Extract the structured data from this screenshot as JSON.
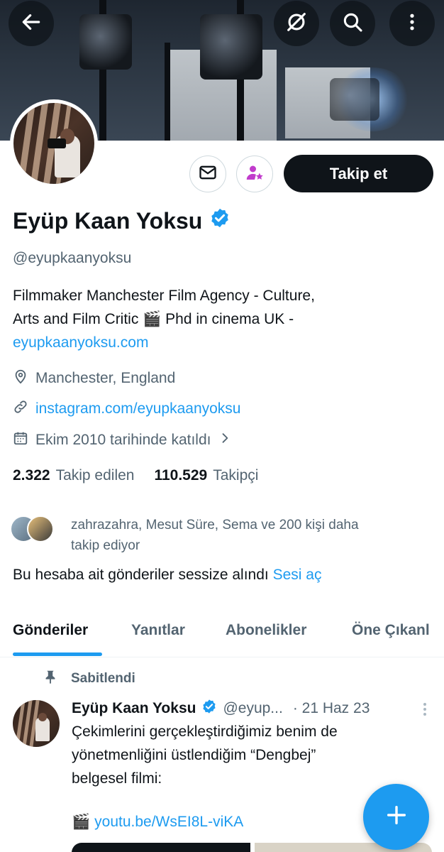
{
  "header": {
    "back_icon": "arrow-left-icon",
    "grok_icon": "slash-circle-icon",
    "search_icon": "search-icon",
    "more_icon": "more-vertical-icon"
  },
  "profile": {
    "name": "Eyüp Kaan Yoksu",
    "verified": true,
    "handle": "@eyupkaanyoksu",
    "bio_line1": "Filmmaker Manchester Film Agency  - Culture,",
    "bio_line2_prefix": "Arts and Film Critic ",
    "bio_line2_emoji": "🎬",
    "bio_line2_suffix": " Phd in cinema UK -",
    "bio_link": "eyupkaanyoksu.com",
    "location": "Manchester, England",
    "website": "instagram.com/eyupkaanyoksu",
    "joined": "Ekim 2010 tarihinde katıldı",
    "following_count": "2.322",
    "following_label": "Takip edilen",
    "followers_count": "110.529",
    "followers_label": "Takipçi",
    "mutual_text_line1": "zahrazahra, Mesut Süre, Sema ve 200 kişi daha",
    "mutual_text_line2": "takip ediyor",
    "muted_text": "Bu hesaba ait gönderiler sessize alındı",
    "unmute_link": "Sesi aç"
  },
  "actions": {
    "message_icon": "envelope-icon",
    "subscribe_icon": "person-star-icon",
    "follow_label": "Takip et"
  },
  "tabs": [
    {
      "label": "Gönderiler",
      "active": true
    },
    {
      "label": "Yanıtlar",
      "active": false
    },
    {
      "label": "Abonelikler",
      "active": false
    },
    {
      "label": "Öne Çıkanl",
      "active": false
    }
  ],
  "post": {
    "pinned_label": "Sabitlendi",
    "author": "Eyüp Kaan Yoksu",
    "handle": "@eyup...",
    "date": "· 21 Haz 23",
    "text_line1": "Çekimlerini gerçekleştirdiğimiz benim de",
    "text_line2": "yönetmenliğini üstlendiğim “Dengbej”",
    "text_line3": "belgesel filmi:",
    "link_emoji": "🎬",
    "link": "youtu.be/WsEI8L-viKA"
  },
  "fab": {
    "icon": "plus-icon"
  },
  "colors": {
    "accent": "#1d9bf0",
    "text": "#0f1419",
    "muted": "#536471",
    "subscribe": "#c13ccc"
  }
}
